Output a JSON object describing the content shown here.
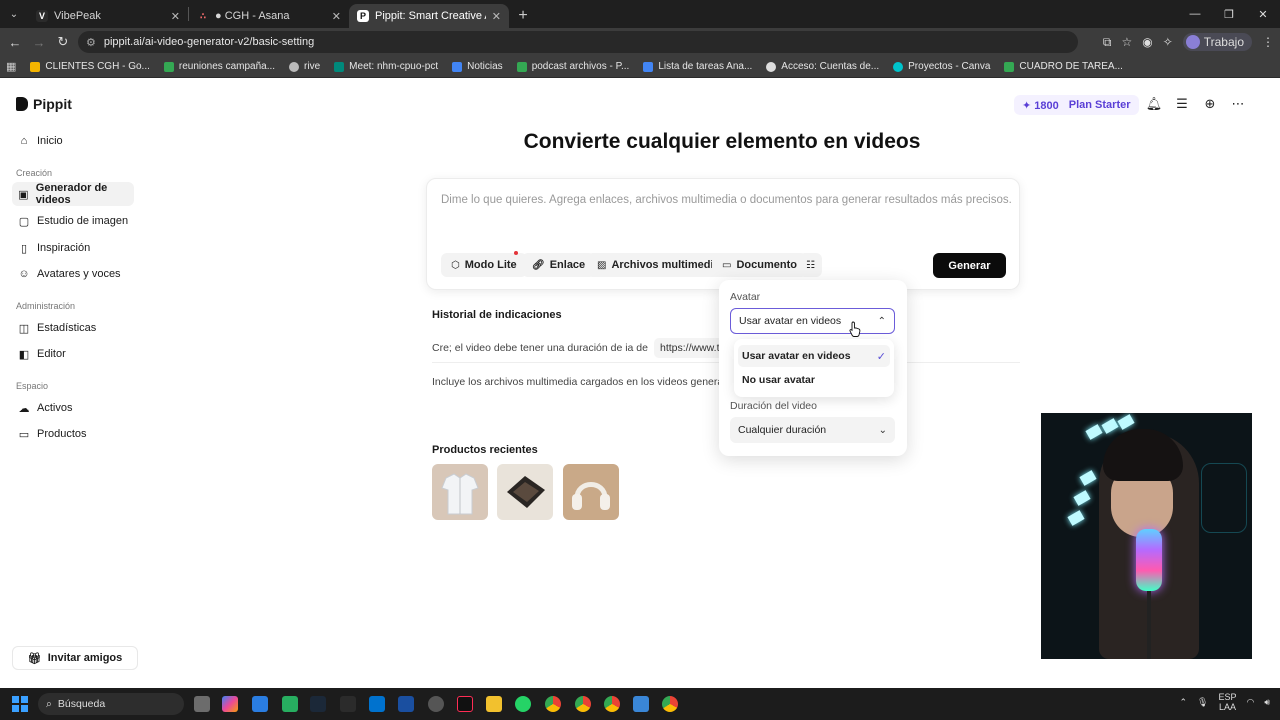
{
  "browser": {
    "tabs": [
      {
        "label": "VibePeak",
        "color": "#2b2b2b",
        "glyph": "V"
      },
      {
        "label": "● CGH - Asana",
        "color": "#f06a6a",
        "glyph": "∴"
      },
      {
        "label": "Pippit: Smart Creative Agent fo",
        "color": "#ffffff",
        "glyph": "P"
      }
    ],
    "url": "pippit.ai/ai-video-generator-v2/basic-setting",
    "profile": "Trabajo",
    "bookmarks": [
      {
        "label": "CLIENTES CGH - Go...",
        "color": "#f4b400"
      },
      {
        "label": "reuniones campaña...",
        "color": "#34a853"
      },
      {
        "label": "rive",
        "color": "#bbbbbb"
      },
      {
        "label": "Meet: nhm-cpuo-pct",
        "color": "#00897b"
      },
      {
        "label": "Noticias",
        "color": "#4285f4"
      },
      {
        "label": "podcast archivos - P...",
        "color": "#34a853"
      },
      {
        "label": "Lista de tareas Ana...",
        "color": "#4285f4"
      },
      {
        "label": "Acceso: Cuentas de...",
        "color": "#dddddd"
      },
      {
        "label": "Proyectos - Canva",
        "color": "#00c4cc"
      },
      {
        "label": "CUADRO DE TAREA...",
        "color": "#34a853"
      }
    ]
  },
  "app": {
    "brand": "Pippit",
    "credits": "1800",
    "plan": "Plan Starter",
    "title": "Convierte cualquier elemento en videos",
    "nav": {
      "home": "Inicio",
      "section_creation": "Creación",
      "video_generator": "Generador de videos",
      "image_studio": "Estudio de imagen",
      "inspiration": "Inspiración",
      "avatars_voices": "Avatares y voces",
      "section_admin": "Administración",
      "stats": "Estadísticas",
      "editor": "Editor",
      "section_space": "Espacio",
      "assets": "Activos",
      "products": "Productos",
      "invite": "Invitar amigos"
    },
    "prompt": {
      "placeholder": "Dime lo que quieres. Agrega enlaces, archivos multimedia o documentos para generar resultados más precisos.",
      "lite_mode": "Modo Lite",
      "link": "Enlace",
      "media": "Archivos multimedia",
      "document": "Documento",
      "generate": "Generar"
    },
    "history": {
      "title": "Historial de indicaciones",
      "item1": "Cre; el video debe tener una duración de  ia de",
      "item1_link": "https://www.trisk",
      "item2": "Incluye los archivos multimedia cargados en los videos generados"
    },
    "recent": {
      "title": "Productos recientes"
    },
    "settings_panel": {
      "avatar_label": "Avatar",
      "avatar_value": "Usar avatar en videos",
      "avatar_options": [
        "Usar avatar en videos",
        "No usar avatar"
      ],
      "duration_label": "Duración del video",
      "duration_value": "Cualquier duración"
    }
  },
  "taskbar": {
    "search": "Búsqueda",
    "lang_top": "ESP",
    "lang_bottom": "LAA"
  },
  "colors": {
    "accent": "#5a3fd6",
    "select_border": "#6b5cd9",
    "generate_bg": "#0b0b0b"
  }
}
